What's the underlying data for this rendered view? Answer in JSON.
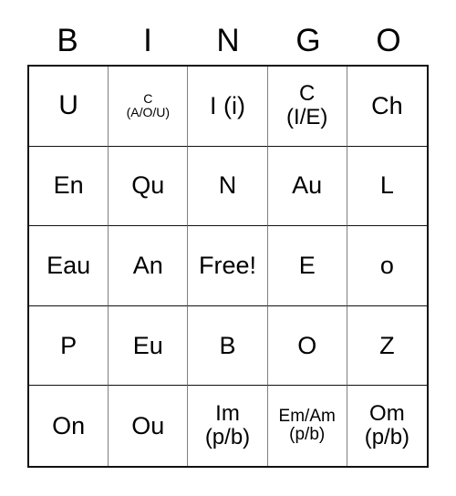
{
  "card": {
    "type": "bingo-card",
    "columns": 5,
    "rows": 5,
    "header": {
      "letters": [
        "B",
        "I",
        "N",
        "G",
        "O"
      ]
    },
    "cells": [
      [
        {
          "text": "U",
          "size": "xl"
        },
        {
          "text": "C\n(A/O/U)",
          "size": "xs"
        },
        {
          "text": "I (i)",
          "size": "lg"
        },
        {
          "text": "C\n(I/E)",
          "size": "md"
        },
        {
          "text": "Ch",
          "size": "lg"
        }
      ],
      [
        {
          "text": "En",
          "size": "lg"
        },
        {
          "text": "Qu",
          "size": "lg"
        },
        {
          "text": "N",
          "size": "lg"
        },
        {
          "text": "Au",
          "size": "lg"
        },
        {
          "text": "L",
          "size": "lg"
        }
      ],
      [
        {
          "text": "Eau",
          "size": "lg"
        },
        {
          "text": "An",
          "size": "lg"
        },
        {
          "text": "Free!",
          "size": "lg"
        },
        {
          "text": "E",
          "size": "lg"
        },
        {
          "text": "o",
          "size": "lg"
        }
      ],
      [
        {
          "text": "P",
          "size": "lg"
        },
        {
          "text": "Eu",
          "size": "lg"
        },
        {
          "text": "B",
          "size": "lg"
        },
        {
          "text": "O",
          "size": "lg"
        },
        {
          "text": "Z",
          "size": "lg"
        }
      ],
      [
        {
          "text": "On",
          "size": "lg"
        },
        {
          "text": "Ou",
          "size": "lg"
        },
        {
          "text": "Im\n(p/b)",
          "size": "md"
        },
        {
          "text": "Em/Am\n(p/b)",
          "size": "sm"
        },
        {
          "text": "Om\n(p/b)",
          "size": "md"
        }
      ]
    ],
    "free_space": {
      "row": 2,
      "column": 2,
      "label": "Free!"
    },
    "colors": {
      "background": "#ffffff",
      "text": "#000000",
      "grid_outer_border": "#111111",
      "grid_inner_vertical": "#808080",
      "grid_inner_horizontal": "#111111"
    }
  }
}
